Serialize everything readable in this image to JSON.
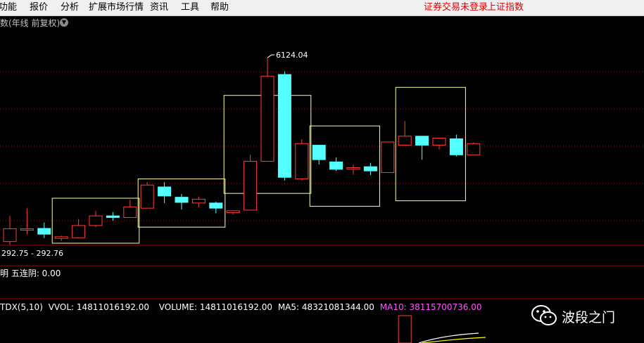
{
  "menu": {
    "items": [
      "功能",
      "报价",
      "分析",
      "扩展市场行情",
      "资讯",
      "工具",
      "帮助"
    ],
    "status_login": "证券交易未登录",
    "status_index": "上证指数"
  },
  "chart_title": "数(年线 前复权)",
  "chart_data": {
    "type": "candlestick",
    "period": "yearly",
    "adjustment": "前复权",
    "ylim": [
      0,
      7000
    ],
    "annotations": {
      "high_label": "6124.04",
      "low_label": "292.75 - 292.76"
    },
    "colors": {
      "up": "#ff3d3d",
      "down": "#54ffff",
      "box": "#ffffa0",
      "grid": "#8b1a1a",
      "volume": "#ff3d3d"
    },
    "candles": [
      {
        "o": 401,
        "h": 1200,
        "l": 300,
        "c": 800
      },
      {
        "o": 780,
        "h": 1430,
        "l": 620,
        "c": 800
      },
      {
        "o": 810,
        "h": 990,
        "l": 510,
        "c": 630
      },
      {
        "o": 500,
        "h": 580,
        "l": 420,
        "c": 550
      },
      {
        "o": 520,
        "h": 1100,
        "l": 500,
        "c": 900
      },
      {
        "o": 900,
        "h": 1350,
        "l": 850,
        "c": 1200
      },
      {
        "o": 1200,
        "h": 1320,
        "l": 1050,
        "c": 1150
      },
      {
        "o": 1150,
        "h": 1700,
        "l": 1150,
        "c": 1480
      },
      {
        "o": 1440,
        "h": 2250,
        "l": 1440,
        "c": 2160
      },
      {
        "o": 2100,
        "h": 2250,
        "l": 1600,
        "c": 1820
      },
      {
        "o": 1780,
        "h": 1880,
        "l": 1400,
        "c": 1620
      },
      {
        "o": 1600,
        "h": 1800,
        "l": 1460,
        "c": 1720
      },
      {
        "o": 1600,
        "h": 1640,
        "l": 1280,
        "c": 1440
      },
      {
        "o": 1300,
        "h": 1360,
        "l": 1240,
        "c": 1360
      },
      {
        "o": 1380,
        "h": 3100,
        "l": 1380,
        "c": 2900
      },
      {
        "o": 2900,
        "h": 6124.04,
        "l": 2900,
        "c": 5550
      },
      {
        "o": 5600,
        "h": 5700,
        "l": 2300,
        "c": 2400
      },
      {
        "o": 2350,
        "h": 3580,
        "l": 2300,
        "c": 3450
      },
      {
        "o": 3400,
        "h": 3400,
        "l": 2800,
        "c": 2950
      },
      {
        "o": 2880,
        "h": 3020,
        "l": 2600,
        "c": 2650
      },
      {
        "o": 2650,
        "h": 2790,
        "l": 2480,
        "c": 2700
      },
      {
        "o": 2730,
        "h": 2850,
        "l": 2470,
        "c": 2600
      },
      {
        "o": 2550,
        "h": 3500,
        "l": 2550,
        "c": 3500
      },
      {
        "o": 3400,
        "h": 4150,
        "l": 3400,
        "c": 3680
      },
      {
        "o": 3680,
        "h": 3650,
        "l": 2950,
        "c": 3400
      },
      {
        "o": 3400,
        "h": 3580,
        "l": 3270,
        "c": 3620
      },
      {
        "o": 3600,
        "h": 3730,
        "l": 3050,
        "c": 3100
      },
      {
        "o": 3100,
        "h": 3480,
        "l": 3100,
        "c": 3450
      }
    ],
    "boxes": [
      {
        "from": 3,
        "to": 7,
        "high": 1750,
        "low": 350
      },
      {
        "from": 8,
        "to": 12,
        "high": 2350,
        "low": 850
      },
      {
        "from": 13,
        "to": 17,
        "high": 4950,
        "low": 1900
      },
      {
        "from": 18,
        "to": 21,
        "high": 4000,
        "low": 1500
      },
      {
        "from": 23,
        "to": 26,
        "high": 5200,
        "low": 1670
      }
    ],
    "volume_tail": [
      0.95
    ]
  },
  "indicator": {
    "text": "明  五连阴: 0.00"
  },
  "volume": {
    "tdx": "TDX(5,10)",
    "vvol": "VVOL: 14811016192.00",
    "volume": "VOLUME: 14811016192.00",
    "ma5": "MA5: 48321081344.00",
    "ma10": "MA10: 38115700736.00",
    "colors": {
      "tdx": "#ffffff",
      "vvol": "#ffffff",
      "volume": "#ffffff",
      "ma5": "#ffffff",
      "ma10": "#ff55ff"
    }
  },
  "watermark": {
    "text": "波段之门",
    "icon": "wechat-icon"
  }
}
